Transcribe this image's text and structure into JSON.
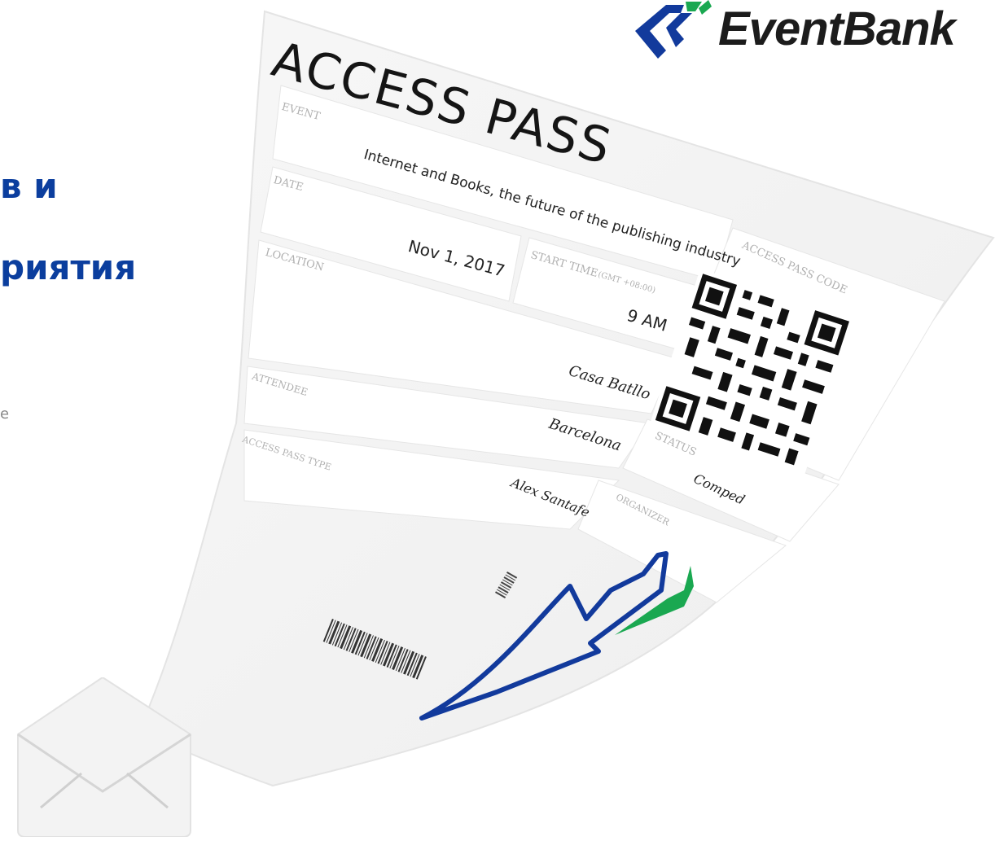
{
  "left_panel": {
    "heading_line1": "в и",
    "heading_line2": "риятия",
    "small_text": "e"
  },
  "logo": {
    "text": "EventBank",
    "colors": {
      "blue": "#123a9c",
      "green": "#1aa851"
    }
  },
  "ticket": {
    "title": "ACCESS PASS",
    "event": {
      "label": "EVENT",
      "value": "Internet and Books, the future of the publishing industry"
    },
    "date": {
      "label": "DATE",
      "value": "Nov 1, 2017"
    },
    "start_time": {
      "label": "START TIME",
      "tz": "(GMT +08:00)",
      "value": "9 AM"
    },
    "location": {
      "label": "LOCATION",
      "venue": "Casa Batllo",
      "city": "Barcelona"
    },
    "attendee": {
      "label": "ATTENDEE",
      "value": "Alex Santafe"
    },
    "access_pass_type": {
      "label": "ACCESS PASS TYPE"
    },
    "access_pass_code": {
      "label": "ACCESS PASS CODE"
    },
    "status": {
      "label": "STATUS",
      "value": "Comped"
    },
    "organizer": {
      "label": "ORGANIZER"
    },
    "barcode_icon": "barcode-icon",
    "qr_icon": "qr-code-icon"
  },
  "envelope_icon": "envelope-icon"
}
